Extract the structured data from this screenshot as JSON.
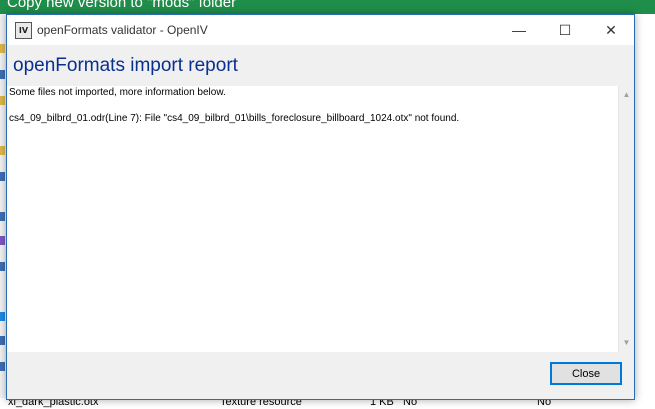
{
  "background": {
    "banner_text": "Copy new version to \"mods\" folder",
    "bottom_row": {
      "name": "xi_dark_plastic.otx",
      "type": "Texture resource",
      "size": "1 KB",
      "col4": "No",
      "col5": "No"
    }
  },
  "dialog": {
    "window_title": "openFormats validator - OpenIV",
    "app_icon_label": "IV",
    "controls": {
      "minimize": "—",
      "maximize": "☐",
      "close": "✕"
    },
    "heading": "openFormats import report",
    "message_lines": [
      "Some files not imported, more information below.",
      "cs4_09_bilbrd_01.odr(Line 7): File \"cs4_09_bilbrd_01\\bills_foreclosure_billboard_1024.otx\" not found."
    ],
    "scroll_up": "▲",
    "scroll_down": "▼",
    "close_button_label": "Close"
  },
  "colors": {
    "banner": "#1f8e4a",
    "heading": "#0a2f8e",
    "button_border": "#0078d7"
  }
}
